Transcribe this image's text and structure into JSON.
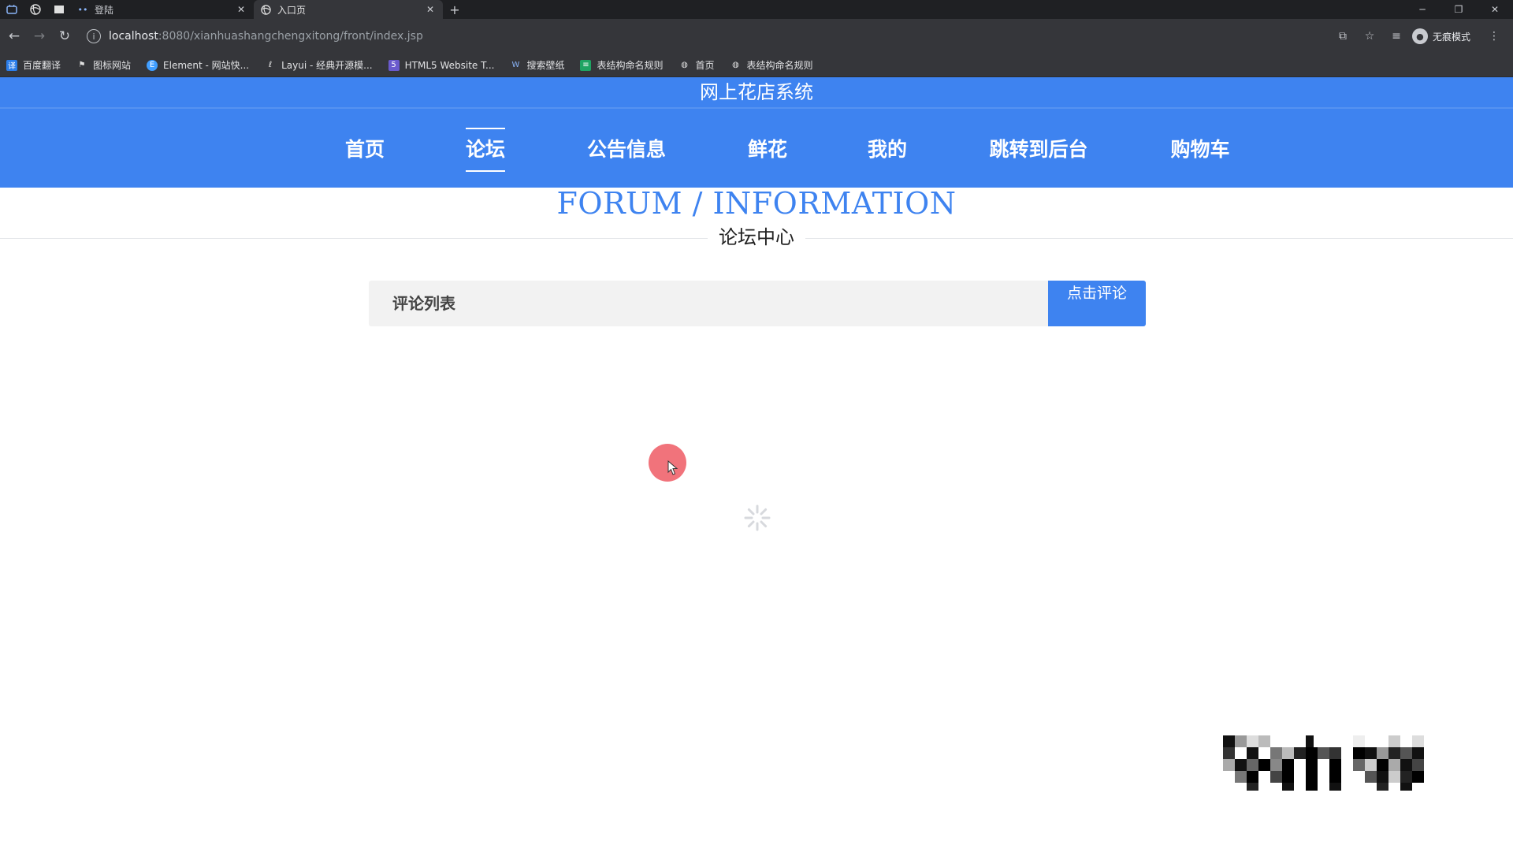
{
  "browser": {
    "tabs": [
      {
        "label": "登陆",
        "active": false
      },
      {
        "label": "入口页",
        "active": true
      }
    ],
    "address": {
      "host": "localhost",
      "path": ":8080/xianhuashangchengxitong/front/index.jsp"
    },
    "incognito_label": "无痕模式",
    "bookmarks": [
      {
        "label": "百度翻译",
        "icon": "baidu-translate-icon",
        "color": "#2b7de9"
      },
      {
        "label": "图标网站",
        "icon": "flag-icon",
        "color": "#444444"
      },
      {
        "label": "Element - 网站快...",
        "icon": "element-icon",
        "color": "#409eff"
      },
      {
        "label": "Layui - 经典开源模...",
        "icon": "layui-icon",
        "color": "#555555"
      },
      {
        "label": "HTML5 Website T...",
        "icon": "html5-icon",
        "color": "#6a5acd"
      },
      {
        "label": "搜索壁纸",
        "icon": "wallpaper-icon",
        "color": "#3b6fd8"
      },
      {
        "label": "表结构命名规则",
        "icon": "sheet-icon",
        "color": "#1fa463"
      },
      {
        "label": "首页",
        "icon": "globe-icon",
        "color": "#777777"
      },
      {
        "label": "表结构命名规则",
        "icon": "globe-icon",
        "color": "#777777"
      }
    ]
  },
  "site": {
    "title": "网上花店系统",
    "nav": [
      {
        "label": "首页",
        "active": false
      },
      {
        "label": "论坛",
        "active": true
      },
      {
        "label": "公告信息",
        "active": false
      },
      {
        "label": "鲜花",
        "active": false
      },
      {
        "label": "我的",
        "active": false
      },
      {
        "label": "跳转到后台",
        "active": false
      },
      {
        "label": "购物车",
        "active": false
      }
    ],
    "accent_color": "#3e83f0"
  },
  "forum": {
    "title_en": "FORUM / INFORMATION",
    "title_cn": "论坛中心",
    "list_label": "评论列表",
    "comment_button": "点击评论"
  }
}
